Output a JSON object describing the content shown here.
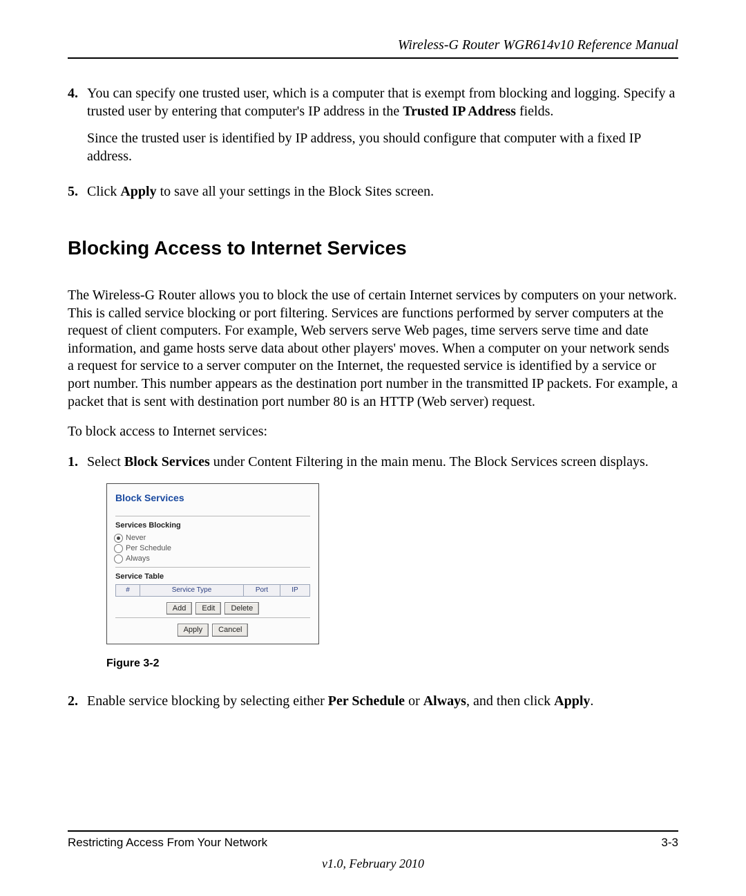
{
  "header": {
    "doc_title": "Wireless-G Router WGR614v10 Reference Manual"
  },
  "steps_a": [
    {
      "num": "4.",
      "para1_pre": "You can specify one trusted user, which is a computer that is exempt from blocking and logging. Specify a trusted user by entering that computer's IP address in the ",
      "para1_bold": "Trusted IP Address",
      "para1_post": " fields.",
      "para2": "Since the trusted user is identified by IP address, you should configure that computer with a fixed IP address."
    },
    {
      "num": "5.",
      "para1_pre": "Click ",
      "para1_bold": "Apply",
      "para1_post": " to save all your settings in the Block Sites screen."
    }
  ],
  "h2": "Blocking Access to Internet Services",
  "intro": "The Wireless-G Router allows you to block the use of certain Internet services by computers on your network. This is called service blocking or port filtering. Services are functions performed by server computers at the request of client computers. For example, Web servers serve Web pages, time servers serve time and date information, and game hosts serve data about other players' moves. When a computer on your network sends a request for service to a server computer on the Internet, the requested service is identified by a service or port number. This number appears as the destination port number in the transmitted IP packets. For example, a packet that is sent with destination port number 80 is an HTTP (Web server) request.",
  "lead": "To block access to Internet services:",
  "steps_b": [
    {
      "num": "1.",
      "pre": "Select ",
      "bold": "Block Services",
      "post": " under Content Filtering in the main menu. The Block Services screen displays."
    },
    {
      "num": "2.",
      "pre": "Enable service blocking by selecting either ",
      "bold1": "Per Schedule",
      "mid": " or ",
      "bold2": "Always",
      "post1": ", and then click ",
      "bold3": "Apply",
      "post2": "."
    }
  ],
  "screenshot": {
    "title": "Block Services",
    "sub1": "Services Blocking",
    "radios": [
      {
        "label": "Never",
        "checked": true
      },
      {
        "label": "Per Schedule",
        "checked": false
      },
      {
        "label": "Always",
        "checked": false
      }
    ],
    "sub2": "Service Table",
    "table_headers": [
      "#",
      "Service Type",
      "Port",
      "IP"
    ],
    "btns1": [
      "Add",
      "Edit",
      "Delete"
    ],
    "btns2": [
      "Apply",
      "Cancel"
    ]
  },
  "figure_caption": "Figure 3-2",
  "footer": {
    "section": "Restricting Access From Your Network",
    "page": "3-3",
    "version": "v1.0, February 2010"
  }
}
